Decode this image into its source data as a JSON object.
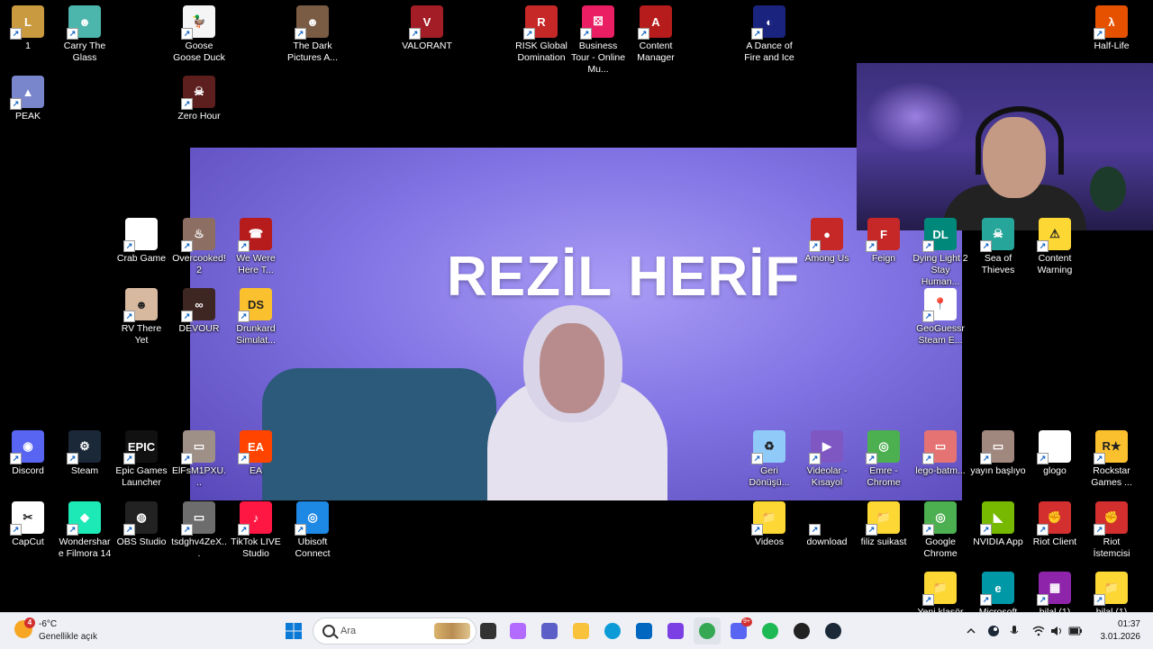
{
  "desktop_icons": [
    {
      "label": "1",
      "color": "#c99a3f",
      "glyph": "L"
    },
    {
      "label": "Carry The Glass",
      "color": "#4db6ac",
      "glyph": "☻"
    },
    {
      "label": "Goose Goose Duck",
      "color": "#f5f5f5",
      "glyph": "🦆"
    },
    {
      "label": "The Dark Pictures A...",
      "color": "#7a5c45",
      "glyph": "☻"
    },
    {
      "label": "VALORANT",
      "color": "#a31d26",
      "glyph": "V"
    },
    {
      "label": "RISK Global Domination",
      "color": "#c62828",
      "glyph": "R"
    },
    {
      "label": "Business Tour - Online Mu...",
      "color": "#e91e63",
      "glyph": "⚄"
    },
    {
      "label": "Content Manager",
      "color": "#b71c1c",
      "glyph": "A"
    },
    {
      "label": "A Dance of Fire and Ice",
      "color": "#1a237e",
      "glyph": "◐"
    },
    {
      "label": "Half-Life",
      "color": "#e65100",
      "glyph": "λ"
    },
    {
      "label": "PEAK",
      "color": "#7986cb",
      "glyph": "▲"
    },
    {
      "label": "Zero Hour",
      "color": "#5d1e1e",
      "glyph": "☠"
    },
    {
      "label": "Crab Game",
      "color": "#ffffff",
      "glyph": ""
    },
    {
      "label": "Overcooked! 2",
      "color": "#8d6e63",
      "glyph": "♨"
    },
    {
      "label": "We Were Here T...",
      "color": "#b71c1c",
      "glyph": "☎"
    },
    {
      "label": "RV There Yet",
      "color": "#d7b9a0",
      "glyph": "☻"
    },
    {
      "label": "DEVOUR",
      "color": "#3e2723",
      "glyph": "∞"
    },
    {
      "label": "Drunkard Simulat...",
      "color": "#fbc02d",
      "glyph": "DS"
    },
    {
      "label": "Among Us",
      "color": "#c62828",
      "glyph": "●"
    },
    {
      "label": "Feign",
      "color": "#c62828",
      "glyph": "F"
    },
    {
      "label": "Dying Light 2 Stay Human...",
      "color": "#00897b",
      "glyph": "DL"
    },
    {
      "label": "Sea of Thieves",
      "color": "#26a69a",
      "glyph": "☠"
    },
    {
      "label": "Content Warning",
      "color": "#fdd835",
      "glyph": "⚠"
    },
    {
      "label": "GeoGuessr Steam E...",
      "color": "#ffffff",
      "glyph": "📍"
    },
    {
      "label": "Discord",
      "color": "#5865f2",
      "glyph": "◉"
    },
    {
      "label": "Steam",
      "color": "#1b2838",
      "glyph": "⚙"
    },
    {
      "label": "Epic Games Launcher",
      "color": "#111111",
      "glyph": "EPIC"
    },
    {
      "label": "ElFsM1PXU...",
      "color": "#9e8f87",
      "glyph": "▭"
    },
    {
      "label": "EA",
      "color": "#ff4400",
      "glyph": "EA"
    },
    {
      "label": "Geri Dönüşü...",
      "color": "#90caf9",
      "glyph": "♻"
    },
    {
      "label": "Videolar - Kısayol",
      "color": "#7e57c2",
      "glyph": "▶"
    },
    {
      "label": "Emre - Chrome",
      "color": "#4caf50",
      "glyph": "◎"
    },
    {
      "label": "lego-batm...",
      "color": "#e57373",
      "glyph": "▭"
    },
    {
      "label": "yayın başlıyo",
      "color": "#a1887f",
      "glyph": "▭"
    },
    {
      "label": "glogo",
      "color": "#ffffff",
      "glyph": ""
    },
    {
      "label": "Rockstar Games ...",
      "color": "#fbc02d",
      "glyph": "R★"
    },
    {
      "label": "CapCut",
      "color": "#ffffff",
      "glyph": "✂"
    },
    {
      "label": "Wondershare Filmora 14",
      "color": "#1de9b6",
      "glyph": "◆"
    },
    {
      "label": "OBS Studio",
      "color": "#222222",
      "glyph": "◍"
    },
    {
      "label": "tsdghv4ZeX...",
      "color": "#6d6d6d",
      "glyph": "▭"
    },
    {
      "label": "TikTok LIVE Studio",
      "color": "#ff1744",
      "glyph": "♪"
    },
    {
      "label": "Ubisoft Connect",
      "color": "#1e88e5",
      "glyph": "◎"
    },
    {
      "label": "Videos",
      "color": "#fdd835",
      "glyph": "📁"
    },
    {
      "label": "download",
      "color": "#000000",
      "glyph": ""
    },
    {
      "label": "filiz suikast",
      "color": "#fdd835",
      "glyph": "📁"
    },
    {
      "label": "Google Chrome",
      "color": "#4caf50",
      "glyph": "◎"
    },
    {
      "label": "NVIDIA App",
      "color": "#76b900",
      "glyph": "◣"
    },
    {
      "label": "Riot Client",
      "color": "#d32f2f",
      "glyph": "✊"
    },
    {
      "label": "Riot İstemcisi",
      "color": "#d32f2f",
      "glyph": "✊"
    },
    {
      "label": "Yeni klasör",
      "color": "#fdd835",
      "glyph": "📁"
    },
    {
      "label": "Microsoft",
      "color": "#0097a7",
      "glyph": "e"
    },
    {
      "label": "bilal (1)",
      "color": "#8e24aa",
      "glyph": "▦"
    },
    {
      "label": "bilal (1)",
      "color": "#fdd835",
      "glyph": "📁"
    }
  ],
  "video": {
    "title": "REZİL HERİF"
  },
  "taskbar": {
    "weather": {
      "badge": "4",
      "temp": "-6°C",
      "condition": "Genellikle açık"
    },
    "search_placeholder": "Ara",
    "pinned": [
      {
        "name": "start",
        "color": "#0078d4"
      },
      {
        "name": "task-view",
        "color": "#333333"
      },
      {
        "name": "copilot",
        "color": "#b36bff"
      },
      {
        "name": "teams",
        "color": "#5b5fc7"
      },
      {
        "name": "file-explorer",
        "color": "#f9c23c"
      },
      {
        "name": "edge",
        "color": "#0c9bd6"
      },
      {
        "name": "store",
        "color": "#0067c0"
      },
      {
        "name": "clipchamp",
        "color": "#7b3fe4"
      },
      {
        "name": "chrome",
        "color": "#34a853"
      },
      {
        "name": "discord",
        "color": "#5865f2"
      },
      {
        "name": "spotify",
        "color": "#1db954"
      },
      {
        "name": "obs",
        "color": "#222222"
      },
      {
        "name": "steam",
        "color": "#1b2838"
      }
    ],
    "discord_badge": "9+",
    "clock": {
      "time": "01:37",
      "date": "3.01.2026"
    }
  }
}
